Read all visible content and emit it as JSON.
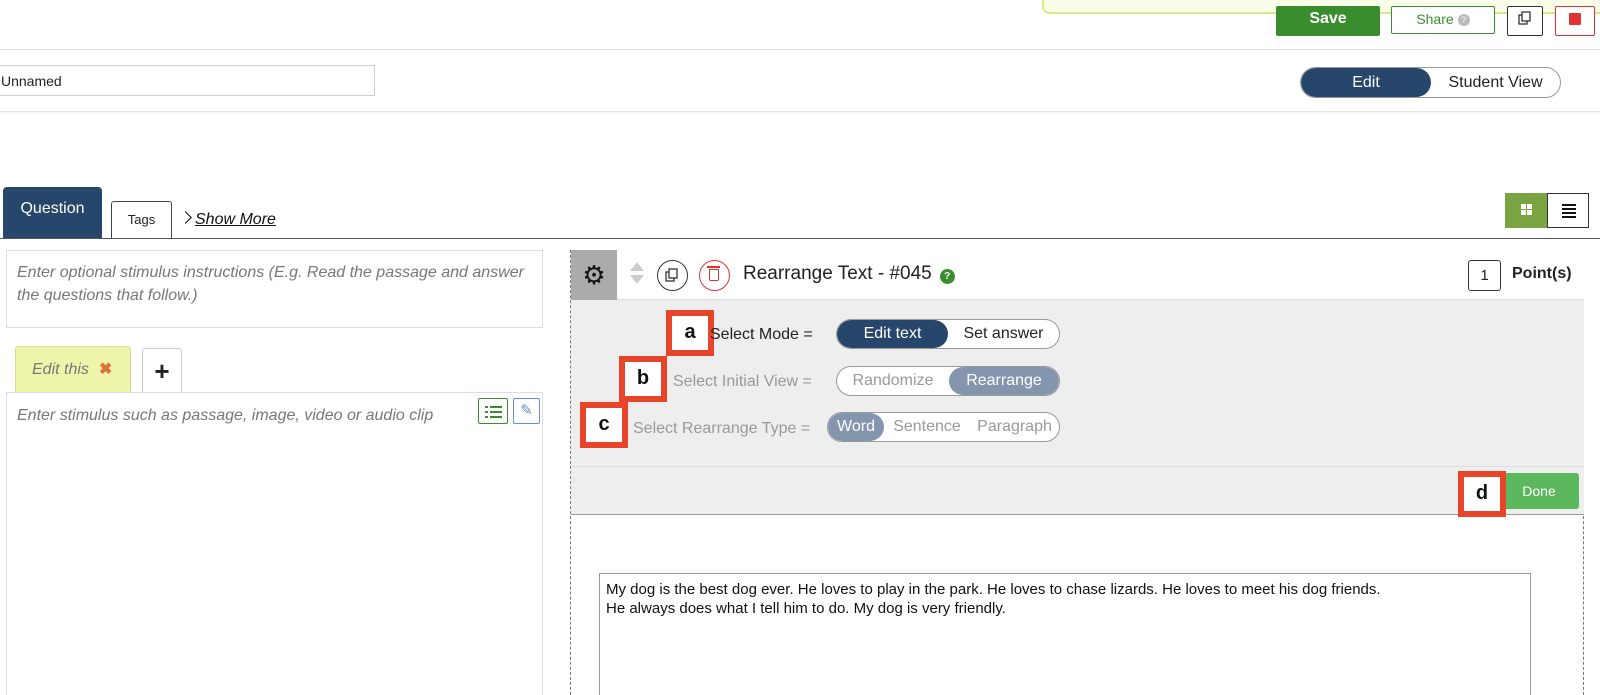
{
  "toolbar": {
    "save_label": "Save",
    "share_label": "Share",
    "share_help": "?"
  },
  "name_row": {
    "name_value": "Unnamed",
    "view_toggle": {
      "edit_label": "Edit",
      "student_label": "Student View",
      "selected": "Edit"
    }
  },
  "tabs": {
    "question_label": "Question",
    "tags_label": "Tags",
    "show_more_label": "Show More"
  },
  "left_panel": {
    "stimulus_instructions_placeholder": "Enter optional stimulus instructions (E.g. Read the passage and answer the questions that follow.)",
    "stimulus_tab_label": "Edit this",
    "stimulus_tab_close": "✖",
    "add_tab_label": "+",
    "stimulus_placeholder": "Enter stimulus such as passage, image, video or audio clip"
  },
  "question": {
    "title": "Rearrange Text - #045",
    "help": "?",
    "points_value": "1",
    "points_label": "Point(s)",
    "settings": {
      "mode_label": "Select Mode =",
      "mode_options": [
        "Edit text",
        "Set answer"
      ],
      "mode_selected": "Edit text",
      "initial_view_label": "Select Initial View =",
      "initial_view_options": [
        "Randomize",
        "Rearrange"
      ],
      "initial_view_selected": "Rearrange",
      "rearrange_type_label": "Select Rearrange Type =",
      "rearrange_type_options": [
        "Word",
        "Sentence",
        "Paragraph"
      ],
      "rearrange_type_selected": "Word",
      "done_label": "Done"
    },
    "markers": [
      "a",
      "b",
      "c",
      "d"
    ],
    "passage_lines": [
      "My dog is the best dog ever.  He loves to play in the park. He loves to chase lizards. He loves to meet his dog friends.",
      "He always does what I tell him to do. My dog is very friendly."
    ]
  },
  "colors": {
    "navy": "#27466b",
    "green": "#3a8d2e",
    "done_green": "#5cb85c",
    "layout_green": "#7aa342",
    "marker_red": "#e8442a",
    "delete_red": "#dd3333",
    "selected_gray": "#8496ae"
  },
  "icons": {
    "duplicate": "duplicate-icon",
    "delete": "trash-icon",
    "settings": "gear-icon",
    "reorder": "sort-arrows-icon",
    "help": "question-icon",
    "list": "list-icon",
    "edit": "pencil-icon",
    "grid_layout": "grid-layout-icon",
    "list_layout": "list-layout-icon",
    "close": "close-icon",
    "add": "plus-icon",
    "chevron": "chevron-right-icon"
  }
}
